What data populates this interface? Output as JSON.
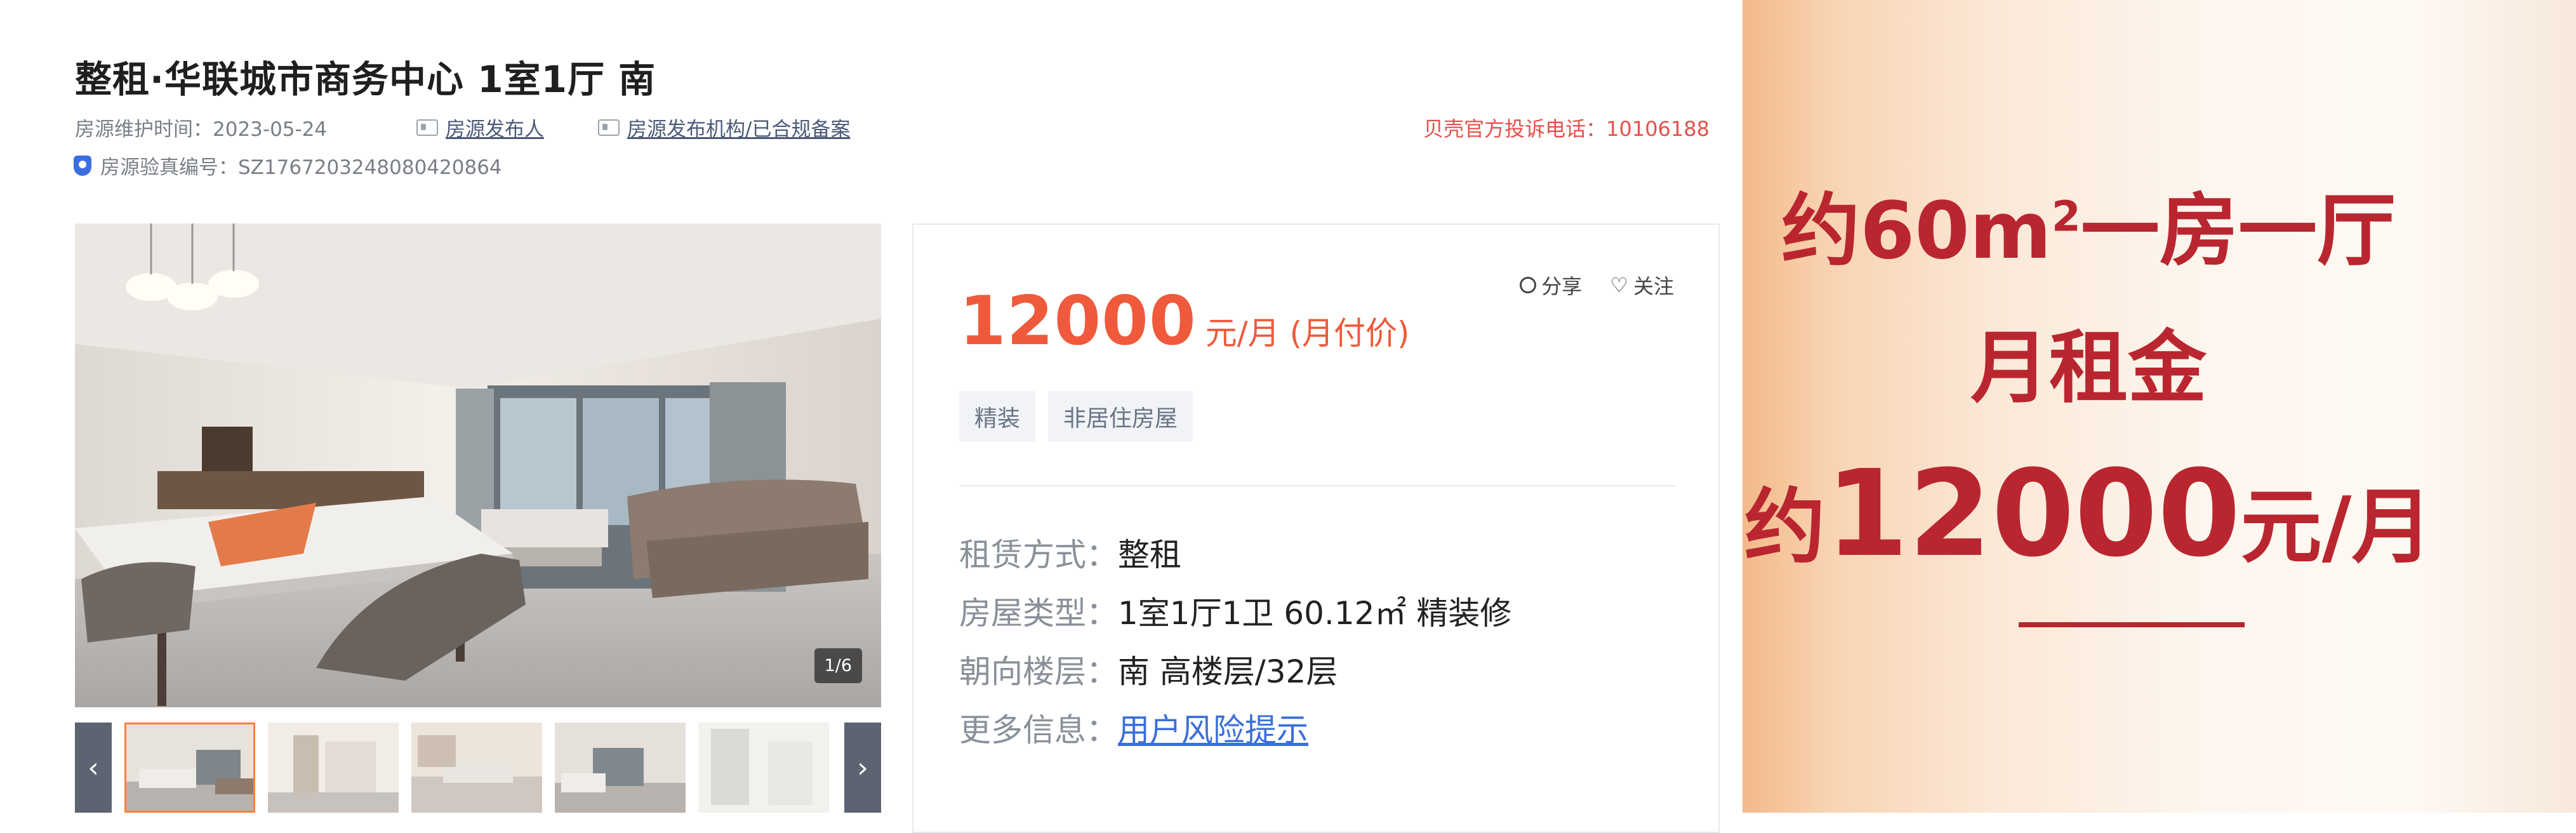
{
  "listing": {
    "title": "整租·华联城市商务中心 1室1厅 南",
    "maintain_time": "房源维护时间：2023-05-24",
    "publisher": "房源发布人",
    "agency": "房源发布机构/已合规备案",
    "complaint": "贝壳官方投诉电话：10106188",
    "verify_code": "房源验真编号：SZ1767203248080420864",
    "photo_counter": "1/6"
  },
  "price": {
    "amount": "12000",
    "unit": "元/月 (月付价)"
  },
  "actions": {
    "share": "分享",
    "follow": "关注"
  },
  "tags": [
    "精装",
    "非居住房屋"
  ],
  "info": [
    {
      "label": "租赁方式：",
      "value": "整租"
    },
    {
      "label": "房屋类型：",
      "value": "1室1厅1卫 60.12㎡ 精装修"
    },
    {
      "label": "朝向楼层：",
      "value": "南 高楼层/32层"
    },
    {
      "label": "更多信息：",
      "value": "用户风险提示"
    }
  ],
  "promo": {
    "line1": "约60m",
    "line1_sup": "2",
    "line1_suffix": "一房一厅",
    "line2": "月租金",
    "line3_prefix": "约",
    "line3_amount": "12000",
    "line3_unit": "元/月"
  },
  "colors": {
    "price": "#ef5a3c",
    "promo_text": "#b9262f",
    "link": "#3b6fd9",
    "complaint": "#e6504b"
  }
}
